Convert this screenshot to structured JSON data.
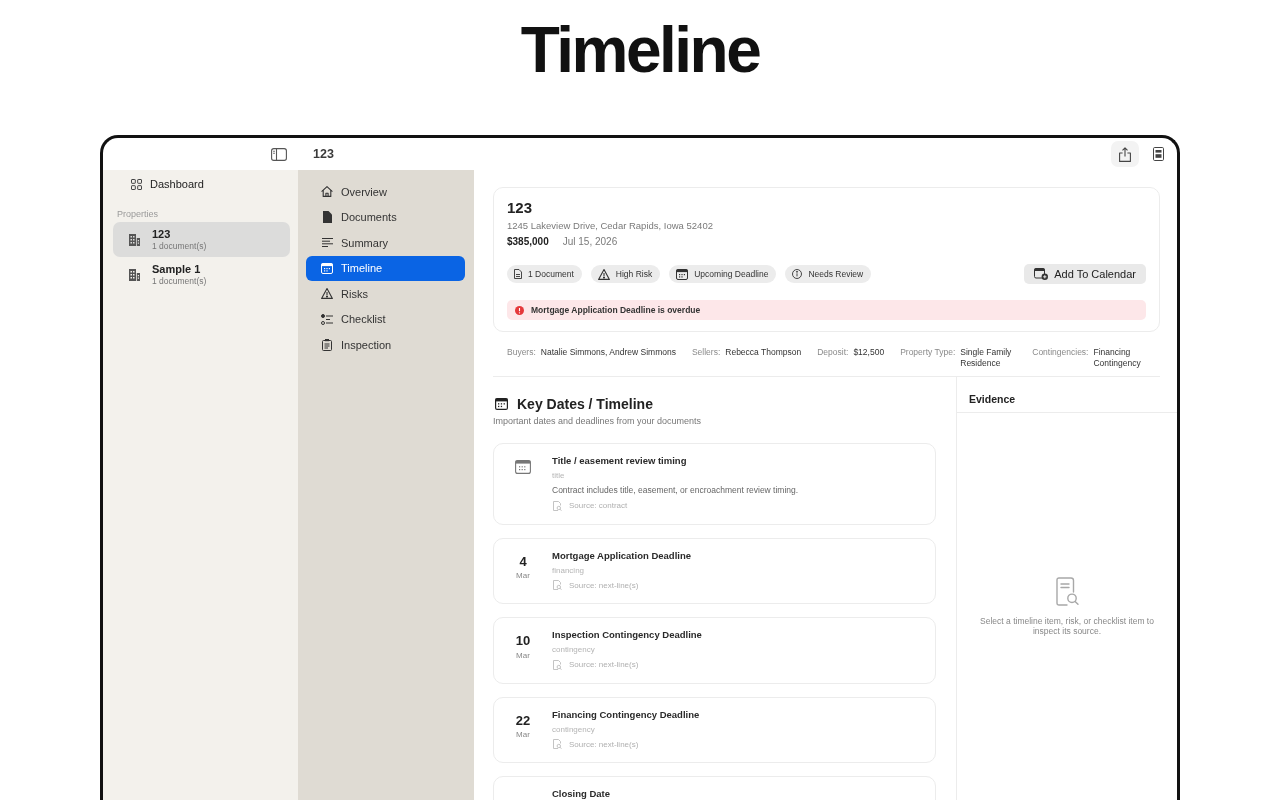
{
  "page_title": "Timeline",
  "toolbar": {
    "title": "123"
  },
  "sidebar": {
    "dashboard": "Dashboard",
    "section_label": "Properties",
    "properties": [
      {
        "name": "123",
        "subtitle": "1 document(s)",
        "selected": true
      },
      {
        "name": "Sample 1",
        "subtitle": "1 document(s)",
        "selected": false
      }
    ]
  },
  "nav": [
    {
      "label": "Overview",
      "selected": false
    },
    {
      "label": "Documents",
      "selected": false
    },
    {
      "label": "Summary",
      "selected": false
    },
    {
      "label": "Timeline",
      "selected": true
    },
    {
      "label": "Risks",
      "selected": false
    },
    {
      "label": "Checklist",
      "selected": false
    },
    {
      "label": "Inspection",
      "selected": false
    }
  ],
  "property": {
    "title": "123",
    "address": "1245 Lakeview Drive, Cedar Rapids, Iowa 52402",
    "price": "$385,000",
    "date": "Jul 15, 2026",
    "tags": [
      "1 Document",
      "High Risk",
      "Upcoming Deadline",
      "Needs Review"
    ],
    "action": "Add To Calendar",
    "alert": "Mortgage Application Deadline is overdue"
  },
  "details": [
    {
      "label": "Buyers:",
      "value": "Natalie Simmons, Andrew Simmons"
    },
    {
      "label": "Sellers:",
      "value": "Rebecca Thompson"
    },
    {
      "label": "Deposit:",
      "value": "$12,500"
    },
    {
      "label": "Property Type:",
      "value": "Single Family Residence"
    },
    {
      "label": "Contingencies:",
      "value": "Financing Contingency"
    }
  ],
  "timeline": {
    "title": "Key Dates / Timeline",
    "subtitle": "Important dates and deadlines from your documents",
    "items": [
      {
        "kind": "undated",
        "title": "Title / easement review timing",
        "category": "title",
        "description": "Contract includes title, easement, or encroachment review timing.",
        "source": "Source: contract"
      },
      {
        "kind": "dated",
        "day": "4",
        "month": "Mar",
        "title": "Mortgage Application Deadline",
        "category": "financing",
        "source": "Source: next-line(s)"
      },
      {
        "kind": "dated",
        "day": "10",
        "month": "Mar",
        "title": "Inspection Contingency Deadline",
        "category": "contingency",
        "source": "Source: next-line(s)"
      },
      {
        "kind": "dated",
        "day": "22",
        "month": "Mar",
        "title": "Financing Contingency Deadline",
        "category": "contingency",
        "source": "Source: next-line(s)"
      },
      {
        "kind": "dated",
        "title": "Closing Date"
      }
    ]
  },
  "evidence": {
    "title": "Evidence",
    "empty_message": "Select a timeline item, risk, or checklist item to inspect its source."
  }
}
